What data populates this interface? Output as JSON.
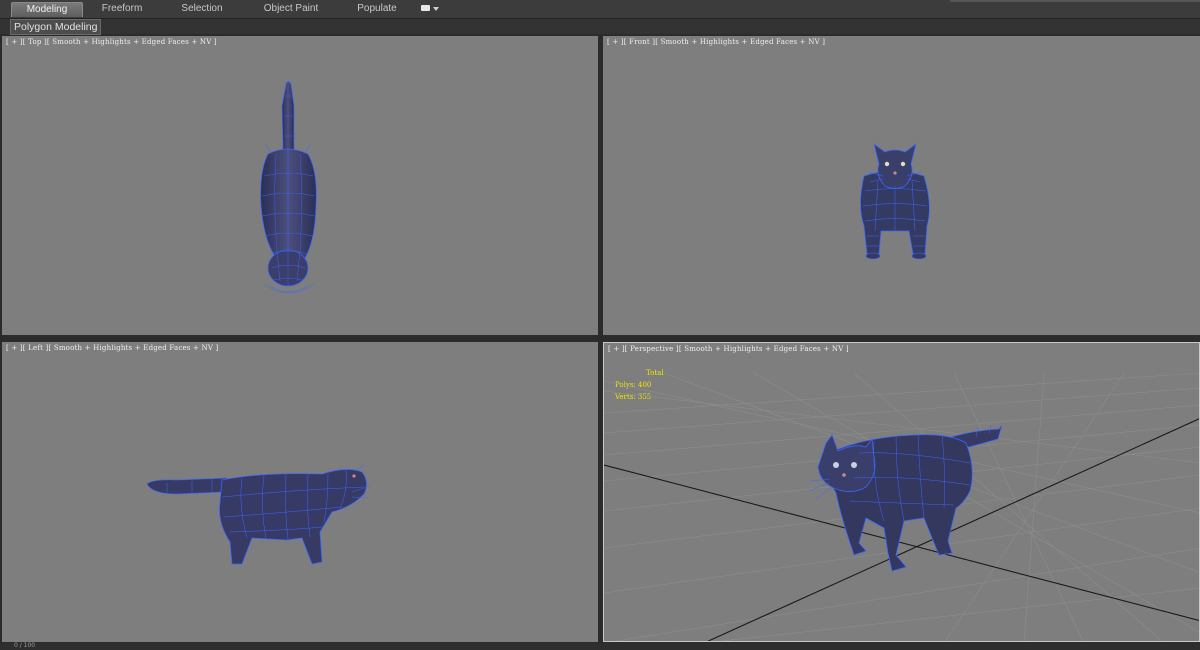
{
  "ribbon": {
    "tabs": [
      {
        "label": "Modeling",
        "active": true
      },
      {
        "label": "Freeform",
        "active": false
      },
      {
        "label": "Selection",
        "active": false
      },
      {
        "label": "Object Paint",
        "active": false
      },
      {
        "label": "Populate",
        "active": false
      }
    ]
  },
  "subbar": {
    "label": "Polygon Modeling"
  },
  "viewports": {
    "top": {
      "label": "[ + ][ Top ][ Smooth + Highlights + Edged Faces + NV ]"
    },
    "front": {
      "label": "[ + ][ Front ][ Smooth + Highlights + Edged Faces + NV ]"
    },
    "left": {
      "label": "[ + ][ Left ][ Smooth + Highlights + Edged Faces + NV ]"
    },
    "perspective": {
      "label": "[ + ][ Perspective ][ Smooth + Highlights + Edged Faces + NV ]",
      "stats": {
        "total_label": "Total",
        "polys": "Polys: 400",
        "verts": "Verts: 355"
      }
    }
  },
  "timeline": {
    "frame": "0 / 100"
  },
  "colors": {
    "viewport_bg": "#7e7e7e",
    "mesh_body": "#3a3f6a",
    "wireframe": "#3b66ff",
    "hud_text": "#f2e600"
  }
}
